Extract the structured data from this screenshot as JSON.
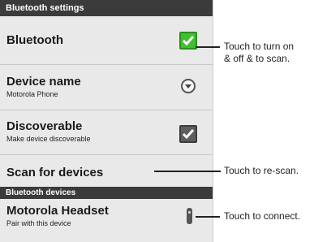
{
  "screen": {
    "title": "Bluetooth settings",
    "rows": {
      "bluetooth": {
        "label": "Bluetooth",
        "checked": true
      },
      "device_name": {
        "label": "Device name",
        "value": "Motorola Phone"
      },
      "discoverable": {
        "label": "Discoverable",
        "sub": "Make device discoverable",
        "checked": true
      },
      "scan": {
        "label": "Scan for devices"
      }
    },
    "devices_header": "Bluetooth devices",
    "device": {
      "name": "Motorola Headset",
      "sub": "Pair with this device"
    }
  },
  "callouts": {
    "toggle_line1": "Touch  to turn on",
    "toggle_line2": "& off & to scan.",
    "rescan": "Touch to re-scan.",
    "connect": "Touch to connect."
  },
  "colors": {
    "checkbox_on": "#40c02f",
    "title_bar": "#3b3b3b",
    "background": "#e9e9e9"
  }
}
